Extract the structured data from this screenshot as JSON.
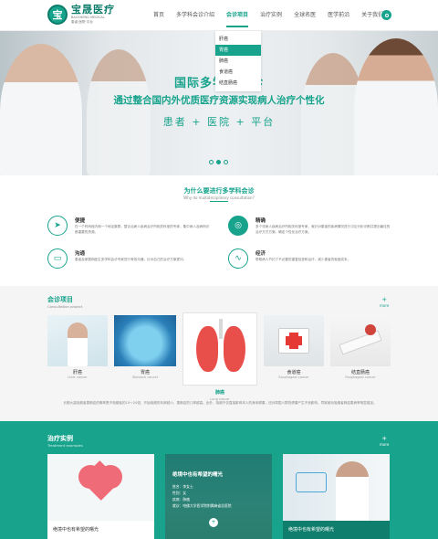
{
  "header": {
    "logo_name": "宝晟医疗",
    "logo_en": "BAOSHENG MEDICAL",
    "logo_slogan": "患者·医院·平台",
    "nav": [
      "首页",
      "多学科会诊介绍",
      "会诊项目",
      "治疗实例",
      "全球名医",
      "医学前沿",
      "关于我们"
    ],
    "active_index": 2
  },
  "dropdown": {
    "items": [
      "肝癌",
      "胃癌",
      "肺癌",
      "食道癌",
      "结直肠癌"
    ],
    "selected_index": 1
  },
  "hero": {
    "title": "国际多学科会诊",
    "subtitle": "通过整合国内外优质医疗资源实现病人治疗个性化",
    "tagline": "患者 + 医院 + 平台",
    "slides": 3,
    "current_slide": 1
  },
  "why": {
    "title": "为什么要进行多学科会诊",
    "subtitle_en": "Why do multidisciplinary consultation?",
    "features": [
      {
        "icon": "paper-plane-icon",
        "title": "便捷",
        "text": "在一个时间段内和一个地址集群，整合治病人疾病治疗所相关科室的专家，集中病人及病例诊断重要的资源。"
      },
      {
        "icon": "target-icon",
        "title": "精确",
        "text": "多个流病人疾病治疗所相关科室专家，就针对患者的疾病情况进行讨论分析诊断并提出最佳的治疗方式方案。确定个性化治疗方案。"
      },
      {
        "icon": "chat-icon",
        "title": "沟通",
        "text": "患者及家属和医生多学科会诊专家进行有效沟通，针对自己的治疗方案提问。"
      },
      {
        "icon": "heartbeat-icon",
        "title": "经济",
        "text": "帮助病人节约了不必要的重复检查和治疗，减少患者的就医成本。"
      }
    ]
  },
  "consult": {
    "title": "会诊项目",
    "subtitle_en": "Consultation project",
    "more": "more",
    "cards": [
      {
        "name": "肝癌",
        "en": "Liver cancer"
      },
      {
        "name": "胃癌",
        "en": "Stomach cancer"
      },
      {
        "name": "肺癌",
        "en": "Lung cancer"
      },
      {
        "name": "食道癌",
        "en": "Esophageal cancer"
      },
      {
        "name": "结直肠癌",
        "en": "Esophageal cancer"
      }
    ],
    "description": "长期大量吸烟者患肺癌的概率是不吸烟者的10～20倍，开始吸烟的年龄越小，患肺癌的几率越高。此外，吸烟不仅直接影响本人的身体健康，还对周围人群的健康产生不良影响，导致被动吸烟者肺癌患病率明显增加。"
  },
  "treatment": {
    "title": "治疗实例",
    "subtitle_en": "Treatment examples",
    "more": "more",
    "cards": [
      {
        "caption": "绝境中也有希望的曙光"
      },
      {
        "caption": "绝境中也有希望的曙光"
      },
      {
        "caption": "绝境中也有希望的曙光"
      }
    ],
    "info": {
      "title": "绝境中也有希望的曙光",
      "lines": [
        "姓名：李女士",
        "性别：女",
        "疾病：肺癌",
        "就诊：哈佛大学医学院附属麻省总医院"
      ],
      "button": "+"
    }
  }
}
